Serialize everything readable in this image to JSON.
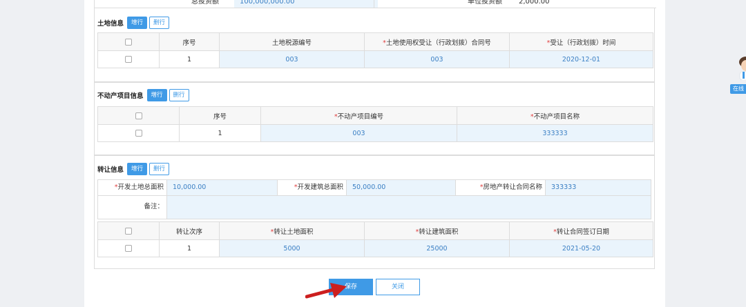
{
  "top_row": {
    "label1": "总投资额",
    "value1": "100,000,000.00",
    "label2": "单位投资额",
    "value2": "2,000.00"
  },
  "land": {
    "title": "土地信息",
    "add_label": "增行",
    "delete_label": "删行",
    "headers": [
      "序号",
      "土地税源编号",
      "*土地使用权受让（行政划拨）合同号",
      "*受让（行政划拨）时间"
    ],
    "rows": [
      [
        "1",
        "003",
        "003",
        "2020-12-01"
      ]
    ]
  },
  "property": {
    "title": "不动产项目信息",
    "add_label": "增行",
    "delete_label": "删行",
    "headers": [
      "序号",
      "*不动产项目编号",
      "*不动产项目名称"
    ],
    "rows": [
      [
        "1",
        "003",
        "333333"
      ]
    ]
  },
  "transfer": {
    "title": "转让信息",
    "add_label": "增行",
    "delete_label": "删行",
    "land_area_label": "*开发土地总面积",
    "land_area_value": "10,000.00",
    "build_area_label": "*开发建筑总面积",
    "build_area_value": "50,000.00",
    "contract_name_label": "*房地产转让合同名称",
    "contract_name_value": "333333",
    "remark_label": "备注：",
    "remark_value": "",
    "headers": [
      "转让次序",
      "*转让土地面积",
      "*转让建筑面积",
      "*转让合同签订日期"
    ],
    "rows": [
      [
        "1",
        "5000",
        "25000",
        "2021-05-20"
      ]
    ]
  },
  "footer": {
    "save_label": "保存",
    "close_label": "关闭"
  },
  "support": {
    "label": "在线"
  },
  "colors": {
    "accent": "#3f9ae6",
    "value_bg": "#eaf4fc",
    "required": "#e04040",
    "arrow": "#cc1f1f"
  }
}
